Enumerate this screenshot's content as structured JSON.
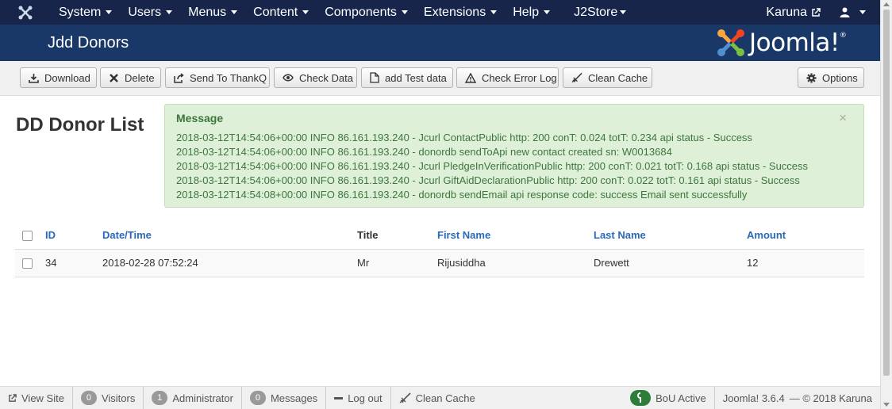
{
  "nav": {
    "items": [
      {
        "label": "System"
      },
      {
        "label": "Users"
      },
      {
        "label": "Menus"
      },
      {
        "label": "Content"
      },
      {
        "label": "Components"
      },
      {
        "label": "Extensions"
      },
      {
        "label": "Help"
      },
      {
        "label": "J2Store"
      }
    ],
    "site_label": "Karuna"
  },
  "header": {
    "title": "Jdd Donors",
    "brand": "Joomla!"
  },
  "toolbar": {
    "download": "Download",
    "delete": "Delete",
    "send": "Send To ThankQ",
    "check_data": "Check Data",
    "add_test": "add Test data",
    "check_error": "Check Error Log",
    "clean_cache": "Clean Cache",
    "options": "Options"
  },
  "page": {
    "title": "DD Donor List"
  },
  "message": {
    "title": "Message",
    "close": "×",
    "lines": [
      "2018-03-12T14:54:06+00:00 INFO 86.161.193.240 - Jcurl ContactPublic http: 200 conT: 0.024 totT: 0.234 api status - Success",
      "2018-03-12T14:54:06+00:00 INFO 86.161.193.240 - donordb sendToApi new contact created sn: W0013684",
      "2018-03-12T14:54:06+00:00 INFO 86.161.193.240 - Jcurl PledgeInVerificationPublic http: 200 conT: 0.021 totT: 0.168 api status - Success",
      "2018-03-12T14:54:06+00:00 INFO 86.161.193.240 - Jcurl GiftAidDeclarationPublic http: 200 conT: 0.022 totT: 0.161 api status - Success",
      "2018-03-12T14:54:08+00:00 INFO 86.161.193.240 - donordb sendEmail api response code: success Email sent successfully"
    ]
  },
  "table": {
    "headers": [
      "ID",
      "Date/Time",
      "Title",
      "First Name",
      "Last Name",
      "Amount"
    ],
    "rows": [
      [
        "34",
        "2018-02-28 07:52:24",
        "Mr",
        "Rijusiddha",
        "Drewett",
        "12"
      ]
    ]
  },
  "footer": {
    "view_site": "View Site",
    "visitors_count": "0",
    "visitors": "Visitors",
    "admin_count": "1",
    "admin": "Administrator",
    "messages_count": "0",
    "messages": "Messages",
    "logout": "Log out",
    "clean_cache": "Clean Cache",
    "bou": "BoU Active",
    "version": "Joomla! 3.6.4",
    "copyright": "— © 2018 Karuna"
  },
  "colors": {
    "nav_bg": "#17254a",
    "header_bg": "#1a3867",
    "message_bg": "#dff0d8",
    "message_text": "#3c763d",
    "link": "#2a69b8"
  }
}
